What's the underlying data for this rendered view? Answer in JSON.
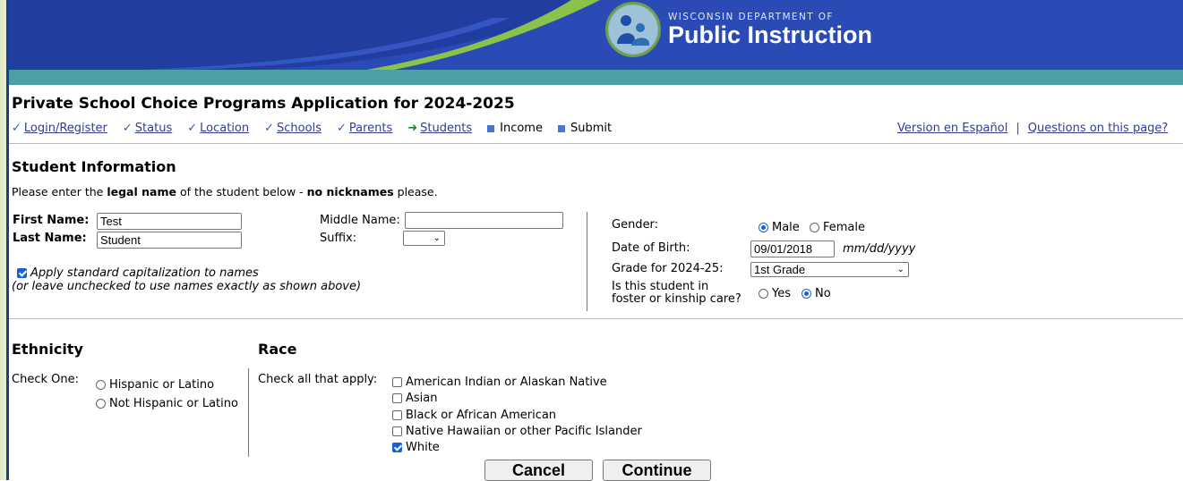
{
  "header": {
    "logo_line1": "WISCONSIN DEPARTMENT OF",
    "logo_line2": "Public Instruction",
    "logo_icon": "dpi-logo-icon"
  },
  "page_title": "Private School Choice Programs Application for 2024-2025",
  "nav": {
    "steps": [
      {
        "label": "Login/Register",
        "state": "done"
      },
      {
        "label": "Status",
        "state": "done"
      },
      {
        "label": "Location",
        "state": "done"
      },
      {
        "label": "Schools",
        "state": "done"
      },
      {
        "label": "Parents",
        "state": "done"
      },
      {
        "label": "Students",
        "state": "current"
      },
      {
        "label": "Income",
        "state": "pending"
      },
      {
        "label": "Submit",
        "state": "pending"
      }
    ],
    "spanish_link": "Version en Español",
    "separator": "|",
    "help_link": "Questions on this page?"
  },
  "student_info": {
    "heading": "Student Information",
    "instruction_pre": "Please enter the ",
    "instruction_bold1": "legal name",
    "instruction_mid": " of the student below - ",
    "instruction_bold2": "no nicknames",
    "instruction_post": " please.",
    "first_name_label": "First Name:",
    "first_name_value": "Test",
    "last_name_label": "Last Name:",
    "last_name_value": "Student",
    "middle_name_label": "Middle Name:",
    "middle_name_value": "",
    "suffix_label": "Suffix:",
    "suffix_value": "",
    "capitalize_label": "Apply standard capitalization to names",
    "capitalize_note": "(or leave unchecked to use names exactly as shown above)",
    "capitalize_checked": true,
    "gender_label": "Gender:",
    "gender_options": [
      "Male",
      "Female"
    ],
    "gender_selected": "Male",
    "dob_label": "Date of Birth:",
    "dob_value": "09/01/2018",
    "dob_format": "mm/dd/yyyy",
    "grade_label": "Grade for 2024-25:",
    "grade_value": "1st Grade",
    "foster_label_1": "Is this student in",
    "foster_label_2": "foster or kinship care?",
    "foster_options": [
      "Yes",
      "No"
    ],
    "foster_selected": "No"
  },
  "ethnicity": {
    "heading": "Ethnicity",
    "check_label": "Check One:",
    "options": [
      "Hispanic or Latino",
      "Not Hispanic or Latino"
    ]
  },
  "race": {
    "heading": "Race",
    "check_label": "Check all that apply:",
    "options": [
      {
        "label": "American Indian or Alaskan Native",
        "checked": false
      },
      {
        "label": "Asian",
        "checked": false
      },
      {
        "label": "Black or African American",
        "checked": false
      },
      {
        "label": "Native Hawaiian or other Pacific Islander",
        "checked": false
      },
      {
        "label": "White",
        "checked": true
      }
    ]
  },
  "buttons": {
    "cancel": "Cancel",
    "continue": "Continue"
  },
  "colors": {
    "banner": "#2a4bb5",
    "teal_bar": "#4d9fa6",
    "link": "#333c8f",
    "accent_green": "#8bc34a"
  }
}
